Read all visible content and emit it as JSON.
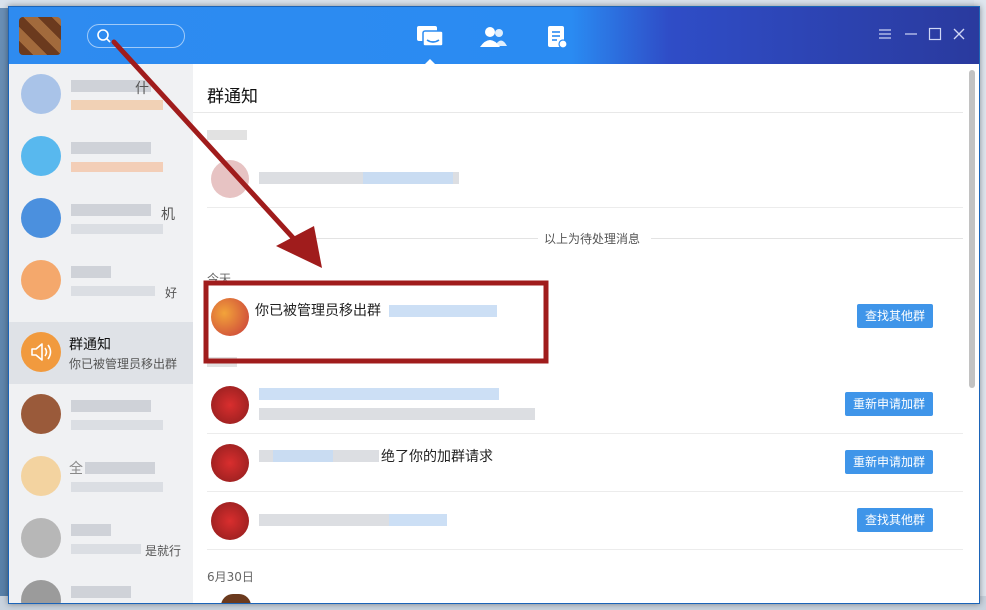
{
  "titlebar": {
    "tabs": [
      {
        "name": "messages",
        "icon": "chat-bubbles-icon",
        "active": true
      },
      {
        "name": "contacts",
        "icon": "contacts-icon",
        "active": false
      },
      {
        "name": "spaces",
        "icon": "document-icon",
        "active": false
      }
    ],
    "controls": [
      "menu-icon",
      "minimize-icon",
      "maximize-icon",
      "close-icon"
    ],
    "colors": {
      "blue": "#2a8bf2",
      "dark_blue": "#2a3a9e"
    }
  },
  "sidebar": {
    "active_item": {
      "name": "群通知",
      "preview": "你已被管理员移出群"
    },
    "partial_text": {
      "item1_tail": "什",
      "item3_tail": "机",
      "item4_tail": "好",
      "item7_tail": "是就行",
      "item6_prefix": "全"
    }
  },
  "main": {
    "title": "群通知",
    "divider_text": "以上为待处理消息",
    "today_label": "今天",
    "date_label": "6月30日",
    "rows": [
      {
        "message": "你已被管理员移出群",
        "button": "查找其他群"
      },
      {
        "message": "",
        "button": "重新申请加群"
      },
      {
        "message": "绝了你的加群请求",
        "button": "重新申请加群"
      },
      {
        "message": "",
        "button": "查找其他群"
      }
    ]
  },
  "annotation": {
    "color": "#a01c1c"
  }
}
